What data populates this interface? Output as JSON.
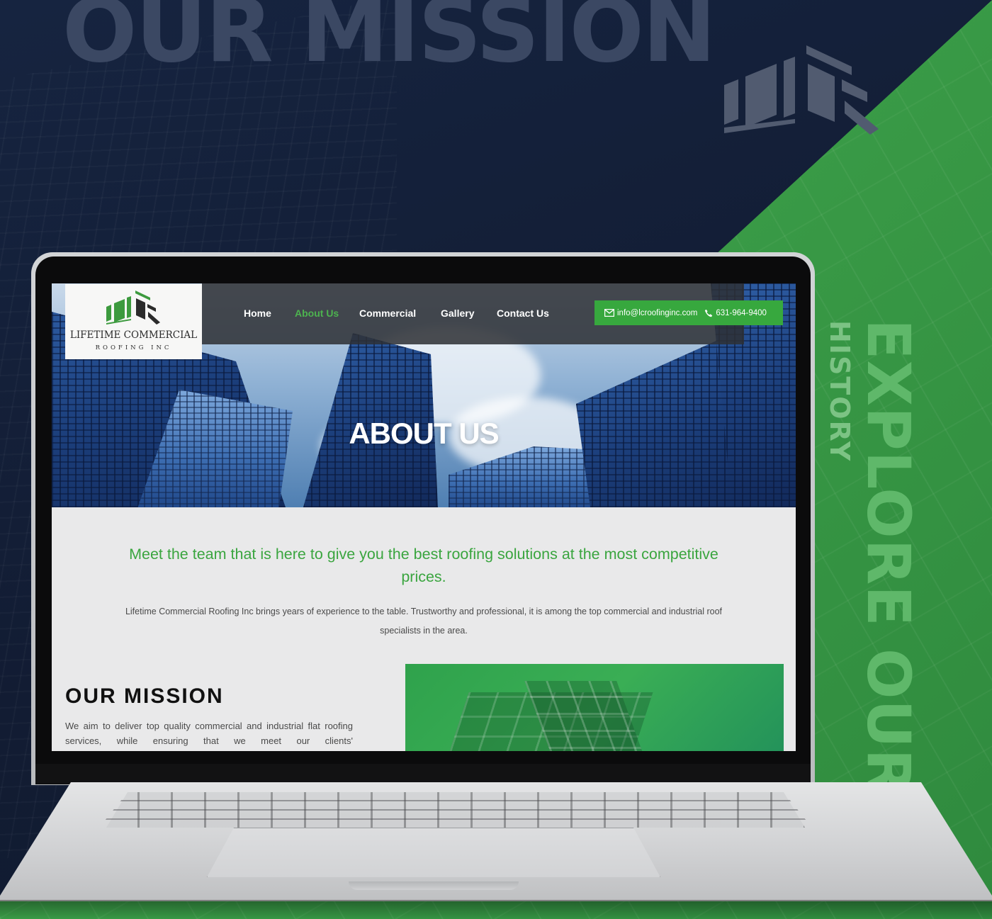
{
  "backdrop": {
    "title": "OUR MISSION",
    "vertical_main": "EXPLORE OUR",
    "vertical_sub": "HISTORY",
    "colors": {
      "navy": "#14203a",
      "green": "#3f9e49"
    },
    "logo_icon": "roofing-logo-icon"
  },
  "site": {
    "logo": {
      "icon": "roofing-logo-icon",
      "line1": "LIFETIME COMMERCIAL",
      "line2": "ROOFING INC"
    },
    "nav": {
      "items": [
        {
          "label": "Home",
          "active": false
        },
        {
          "label": "About Us",
          "active": true
        },
        {
          "label": "Commercial",
          "active": false
        },
        {
          "label": "Gallery",
          "active": false
        },
        {
          "label": "Contact Us",
          "active": false
        }
      ]
    },
    "contact": {
      "email_icon": "envelope-icon",
      "email": "info@lcroofinginc.com",
      "phone_icon": "phone-icon",
      "phone": "631-964-9400"
    },
    "hero": {
      "title": "ABOUT US"
    },
    "tagline": "Meet the team that is here to give you the best roofing solutions at the most competitive prices.",
    "intro": "Lifetime Commercial Roofing Inc brings years of experience to the table. Trustworthy and professional, it is among the top commercial and industrial roof specialists in the area.",
    "mission": {
      "heading": "OUR MISSION",
      "text": "We aim to deliver top quality commercial and industrial flat roofing services, while ensuring that we meet our clients'"
    },
    "colors": {
      "accent": "#37a83e",
      "nav_bg": "#2d3034",
      "text": "#4a4a4a"
    }
  }
}
